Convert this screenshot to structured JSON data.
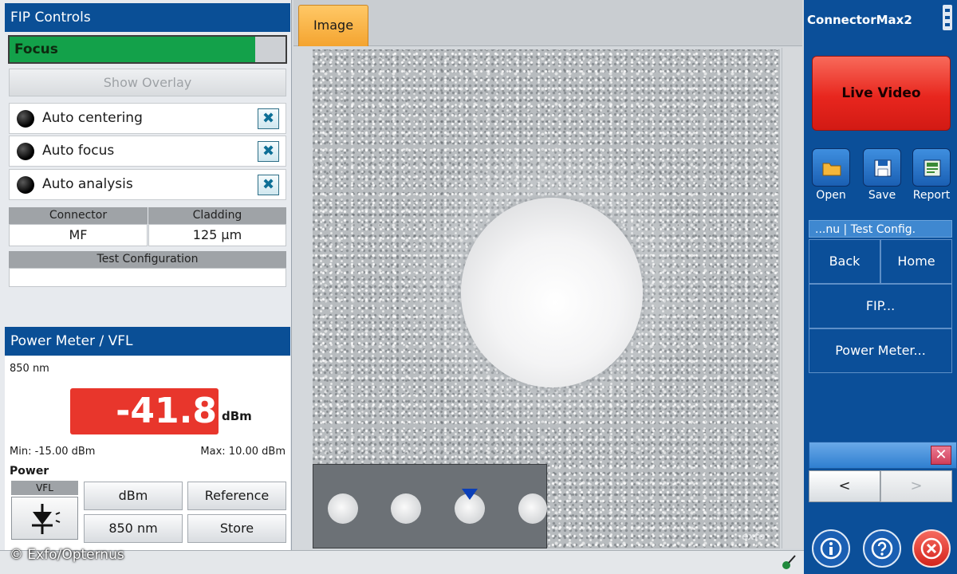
{
  "fip_controls": {
    "header": "FIP Controls",
    "focus": {
      "label": "Focus",
      "level_percent": 89
    },
    "show_overlay_label": "Show Overlay",
    "auto_items": [
      {
        "label": "Auto centering"
      },
      {
        "label": "Auto focus"
      },
      {
        "label": "Auto analysis"
      }
    ],
    "connector_header": "Connector",
    "connector_value": "MF",
    "cladding_header": "Cladding",
    "cladding_value": "125 µm",
    "test_config_header": "Test Configuration",
    "test_config_value": ""
  },
  "power_meter": {
    "header": "Power Meter / VFL",
    "wavelength": "850 nm",
    "reading": "-41.8",
    "unit": "dBm",
    "min_label": "Min: -15.00 dBm",
    "max_label": "Max: 10.00 dBm",
    "power_label": "Power",
    "vfl_label": "VFL",
    "buttons": {
      "unit": "dBm",
      "reference": "Reference",
      "wavelength": "850 nm",
      "store": "Store"
    }
  },
  "viewer": {
    "tab_label": "Image",
    "watermark": "exfo",
    "credit": "© Exfo/Opternus"
  },
  "right_panel": {
    "app_title": "ConnectorMax2",
    "live_video": "Live Video",
    "open": "Open",
    "save": "Save",
    "report": "Report",
    "breadcrumb": "...nu | Test Config.",
    "back": "Back",
    "home": "Home",
    "fip": "FIP...",
    "power_meter": "Power Meter...",
    "prev": "<",
    "next": ">"
  },
  "colors": {
    "header_blue": "#0a4f96",
    "focus_green": "#13a14a",
    "reading_red": "#e8362c",
    "tab_orange": "#f4a430",
    "live_video_red": "#e8261e"
  }
}
